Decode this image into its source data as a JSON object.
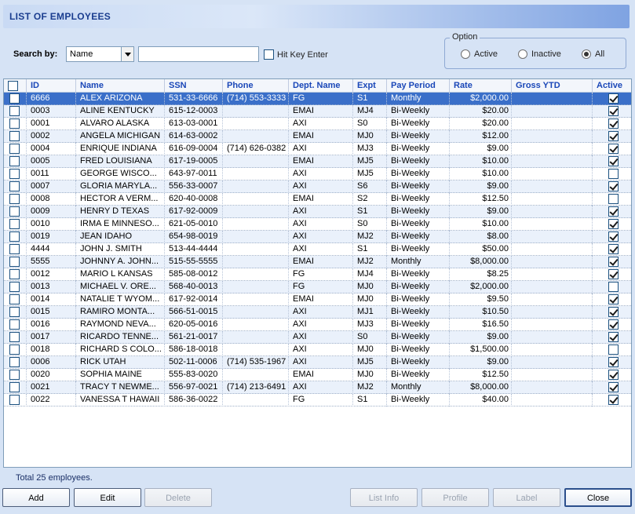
{
  "title": "LIST OF EMPLOYEES",
  "search": {
    "label": "Search by:",
    "field": "Name",
    "value": "",
    "hit_key_label": "Hit Key Enter",
    "hit_key_checked": false
  },
  "option": {
    "legend": "Option",
    "choices": [
      {
        "label": "Active",
        "selected": false
      },
      {
        "label": "Inactive",
        "selected": false
      },
      {
        "label": "All",
        "selected": true
      }
    ]
  },
  "columns": [
    "ID",
    "Name",
    "SSN",
    "Phone",
    "Dept. Name",
    "Expt",
    "Pay Period",
    "Rate",
    "Gross YTD",
    "Active"
  ],
  "rows": [
    {
      "id": "6666",
      "name": "ALEX ARIZONA",
      "ssn": "531-33-6666",
      "phone": "(714) 553-3333",
      "dept": "FG",
      "expt": "S1",
      "pay": "Monthly",
      "rate": "$2,000.00",
      "ytd": "",
      "active": true
    },
    {
      "id": "0003",
      "name": "ALINE KENTUCKY",
      "ssn": "615-12-0003",
      "phone": "",
      "dept": "EMAI",
      "expt": "MJ4",
      "pay": "Bi-Weekly",
      "rate": "$20.00",
      "ytd": "",
      "active": true
    },
    {
      "id": "0001",
      "name": "ALVARO ALASKA",
      "ssn": "613-03-0001",
      "phone": "",
      "dept": "AXI",
      "expt": "S0",
      "pay": "Bi-Weekly",
      "rate": "$20.00",
      "ytd": "",
      "active": true
    },
    {
      "id": "0002",
      "name": "ANGELA MICHIGAN",
      "ssn": "614-63-0002",
      "phone": "",
      "dept": "EMAI",
      "expt": "MJ0",
      "pay": "Bi-Weekly",
      "rate": "$12.00",
      "ytd": "",
      "active": true
    },
    {
      "id": "0004",
      "name": "ENRIQUE INDIANA",
      "ssn": "616-09-0004",
      "phone": "(714) 626-0382",
      "dept": "AXI",
      "expt": "MJ3",
      "pay": "Bi-Weekly",
      "rate": "$9.00",
      "ytd": "",
      "active": true
    },
    {
      "id": "0005",
      "name": "FRED LOUISIANA",
      "ssn": "617-19-0005",
      "phone": "",
      "dept": "EMAI",
      "expt": "MJ5",
      "pay": "Bi-Weekly",
      "rate": "$10.00",
      "ytd": "",
      "active": true
    },
    {
      "id": "0011",
      "name": "GEORGE WISCO...",
      "ssn": "643-97-0011",
      "phone": "",
      "dept": "AXI",
      "expt": "MJ5",
      "pay": "Bi-Weekly",
      "rate": "$10.00",
      "ytd": "",
      "active": false
    },
    {
      "id": "0007",
      "name": "GLORIA MARYLA...",
      "ssn": "556-33-0007",
      "phone": "",
      "dept": "AXI",
      "expt": "S6",
      "pay": "Bi-Weekly",
      "rate": "$9.00",
      "ytd": "",
      "active": true
    },
    {
      "id": "0008",
      "name": "HECTOR A VERM...",
      "ssn": "620-40-0008",
      "phone": "",
      "dept": "EMAI",
      "expt": "S2",
      "pay": "Bi-Weekly",
      "rate": "$12.50",
      "ytd": "",
      "active": false
    },
    {
      "id": "0009",
      "name": "HENRY D TEXAS",
      "ssn": "617-92-0009",
      "phone": "",
      "dept": "AXI",
      "expt": "S1",
      "pay": "Bi-Weekly",
      "rate": "$9.00",
      "ytd": "",
      "active": true
    },
    {
      "id": "0010",
      "name": "IRMA E MINNESO...",
      "ssn": "621-05-0010",
      "phone": "",
      "dept": "AXI",
      "expt": "S0",
      "pay": "Bi-Weekly",
      "rate": "$10.00",
      "ytd": "",
      "active": true
    },
    {
      "id": "0019",
      "name": "JEAN IDAHO",
      "ssn": "654-98-0019",
      "phone": "",
      "dept": "AXI",
      "expt": "MJ2",
      "pay": "Bi-Weekly",
      "rate": "$8.00",
      "ytd": "",
      "active": true
    },
    {
      "id": "4444",
      "name": "JOHN J. SMITH",
      "ssn": "513-44-4444",
      "phone": "",
      "dept": "AXI",
      "expt": "S1",
      "pay": "Bi-Weekly",
      "rate": "$50.00",
      "ytd": "",
      "active": true
    },
    {
      "id": "5555",
      "name": "JOHNNY A. JOHN...",
      "ssn": "515-55-5555",
      "phone": "",
      "dept": "EMAI",
      "expt": "MJ2",
      "pay": "Monthly",
      "rate": "$8,000.00",
      "ytd": "",
      "active": true
    },
    {
      "id": "0012",
      "name": "MARIO L KANSAS",
      "ssn": "585-08-0012",
      "phone": "",
      "dept": "FG",
      "expt": "MJ4",
      "pay": "Bi-Weekly",
      "rate": "$8.25",
      "ytd": "",
      "active": true
    },
    {
      "id": "0013",
      "name": "MICHAEL V. ORE...",
      "ssn": "568-40-0013",
      "phone": "",
      "dept": "FG",
      "expt": "MJ0",
      "pay": "Bi-Weekly",
      "rate": "$2,000.00",
      "ytd": "",
      "active": false
    },
    {
      "id": "0014",
      "name": "NATALIE T WYOM...",
      "ssn": "617-92-0014",
      "phone": "",
      "dept": "EMAI",
      "expt": "MJ0",
      "pay": "Bi-Weekly",
      "rate": "$9.50",
      "ytd": "",
      "active": true
    },
    {
      "id": "0015",
      "name": "RAMIRO MONTA...",
      "ssn": "566-51-0015",
      "phone": "",
      "dept": "AXI",
      "expt": "MJ1",
      "pay": "Bi-Weekly",
      "rate": "$10.50",
      "ytd": "",
      "active": true
    },
    {
      "id": "0016",
      "name": "RAYMOND NEVA...",
      "ssn": "620-05-0016",
      "phone": "",
      "dept": "AXI",
      "expt": "MJ3",
      "pay": "Bi-Weekly",
      "rate": "$16.50",
      "ytd": "",
      "active": true
    },
    {
      "id": "0017",
      "name": "RICARDO TENNE...",
      "ssn": "561-21-0017",
      "phone": "",
      "dept": "AXI",
      "expt": "S0",
      "pay": "Bi-Weekly",
      "rate": "$9.00",
      "ytd": "",
      "active": true
    },
    {
      "id": "0018",
      "name": "RICHARD S COLO...",
      "ssn": "586-18-0018",
      "phone": "",
      "dept": "AXI",
      "expt": "MJ0",
      "pay": "Bi-Weekly",
      "rate": "$1,500.00",
      "ytd": "",
      "active": false
    },
    {
      "id": "0006",
      "name": "RICK UTAH",
      "ssn": "502-11-0006",
      "phone": "(714) 535-1967",
      "dept": "AXI",
      "expt": "MJ5",
      "pay": "Bi-Weekly",
      "rate": "$9.00",
      "ytd": "",
      "active": true
    },
    {
      "id": "0020",
      "name": "SOPHIA MAINE",
      "ssn": "555-83-0020",
      "phone": "",
      "dept": "EMAI",
      "expt": "MJ0",
      "pay": "Bi-Weekly",
      "rate": "$12.50",
      "ytd": "",
      "active": true
    },
    {
      "id": "0021",
      "name": "TRACY T NEWME...",
      "ssn": "556-97-0021",
      "phone": "(714) 213-6491",
      "dept": "AXI",
      "expt": "MJ2",
      "pay": "Monthly",
      "rate": "$8,000.00",
      "ytd": "",
      "active": true
    },
    {
      "id": "0022",
      "name": "VANESSA T HAWAII",
      "ssn": "586-36-0022",
      "phone": "",
      "dept": "FG",
      "expt": "S1",
      "pay": "Bi-Weekly",
      "rate": "$40.00",
      "ytd": "",
      "active": true
    }
  ],
  "total_text": "Total 25 employees.",
  "buttons": {
    "add": "Add",
    "edit": "Edit",
    "delete": "Delete",
    "list_info": "List Info",
    "profile": "Profile",
    "label": "Label",
    "close": "Close"
  },
  "colors": {
    "selected_row": "#3a6fc9",
    "header_text": "#1a47b8",
    "title_text": "#1a3d8f"
  }
}
